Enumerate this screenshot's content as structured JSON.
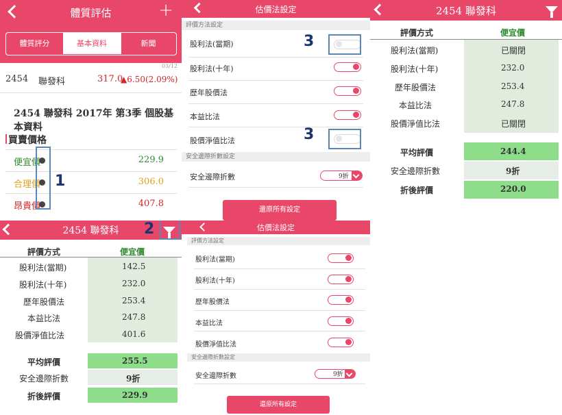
{
  "p1": {
    "title": "體質評估",
    "add": "+",
    "tabs": [
      "體質評分",
      "基本資料",
      "新聞"
    ],
    "date": "03/12",
    "code": "2454",
    "name": "聯發科",
    "price": "317.0",
    "change": "▲6.50(2.09%)",
    "headline": "2454 聯發科 2017年 第3季 個股基本資料",
    "section": "買賣價格",
    "rows": [
      {
        "label": "便宜價",
        "value": "229.9",
        "color": "#2e8b2e"
      },
      {
        "label": "合理價",
        "value": "306.0",
        "color": "#e0a01a"
      },
      {
        "label": "昂貴價",
        "value": "407.8",
        "color": "#d42424"
      }
    ],
    "annot": "1"
  },
  "p2": {
    "title": "2454 聯發科",
    "annot": "2",
    "head": [
      "評價方式",
      "便宜價"
    ],
    "rows": [
      [
        "股利法(當期)",
        "142.5"
      ],
      [
        "股利法(十年)",
        "232.0"
      ],
      [
        "歷年股價法",
        "253.4"
      ],
      [
        "本益比法",
        "247.8"
      ],
      [
        "股價淨值比法",
        "401.6"
      ]
    ],
    "avg": [
      "平均評價",
      "255.5"
    ],
    "safety": [
      "安全邊際折數",
      "9折"
    ],
    "after": [
      "折後評價",
      "229.9"
    ]
  },
  "p3": {
    "title": "估價法設定",
    "sec1": "評價方法設定",
    "items": [
      "股利法(當期)",
      "股利法(十年)",
      "歷年股價法",
      "本益比法",
      "股價淨值比法"
    ],
    "states": [
      false,
      true,
      true,
      true,
      false
    ],
    "sec2": "安全邊際折數設定",
    "safety_label": "安全邊際折數",
    "safety_value": "9折",
    "reset": "還原所有設定",
    "annot": "3"
  },
  "p4": {
    "title": "估價法設定",
    "sec1": "評價方法設定",
    "items": [
      "股利法(當期)",
      "股利法(十年)",
      "歷年股價法",
      "本益比法",
      "股價淨值比法"
    ],
    "sec2": "安全邊際折數設定",
    "safety_label": "安全邊際折數",
    "safety_value": "9折",
    "reset": "還原所有設定"
  },
  "p5": {
    "title": "2454 聯發科",
    "head": [
      "評價方式",
      "便宜價"
    ],
    "rows": [
      [
        "股利法(當期)",
        "已關閉"
      ],
      [
        "股利法(十年)",
        "232.0"
      ],
      [
        "歷年股價法",
        "253.4"
      ],
      [
        "本益比法",
        "247.8"
      ],
      [
        "股價淨值比法",
        "已關閉"
      ]
    ],
    "avg": [
      "平均評價",
      "244.4"
    ],
    "safety": [
      "安全邊際折數",
      "9折"
    ],
    "after": [
      "折後評價",
      "220.0"
    ]
  }
}
